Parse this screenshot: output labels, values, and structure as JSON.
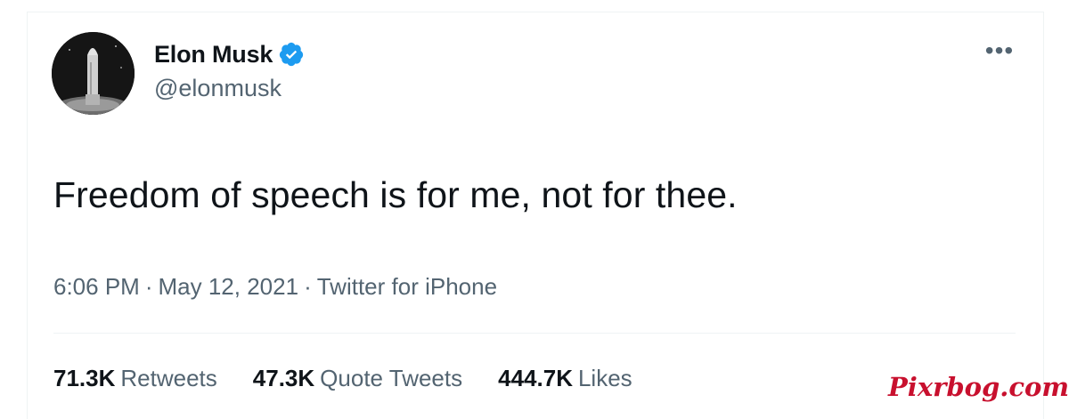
{
  "author": {
    "display_name": "Elon Musk",
    "handle": "@elonmusk",
    "verified": true,
    "avatar_icon": "rocket-avatar"
  },
  "menu": {
    "more_label": "•••"
  },
  "tweet": {
    "text": "Freedom of speech is for me, not for thee.",
    "time": "6:06 PM",
    "date": "May 12, 2021",
    "source": "Twitter for iPhone",
    "separator": "·"
  },
  "stats": [
    {
      "count": "71.3K",
      "label": "Retweets"
    },
    {
      "count": "47.3K",
      "label": "Quote Tweets"
    },
    {
      "count": "444.7K",
      "label": "Likes"
    }
  ],
  "watermark": "Pixrbog.com",
  "colors": {
    "text_primary": "#0f1419",
    "text_secondary": "#536471",
    "verified_blue": "#1d9bf0",
    "divider": "#eff3f4",
    "watermark_red": "#c8102e"
  }
}
